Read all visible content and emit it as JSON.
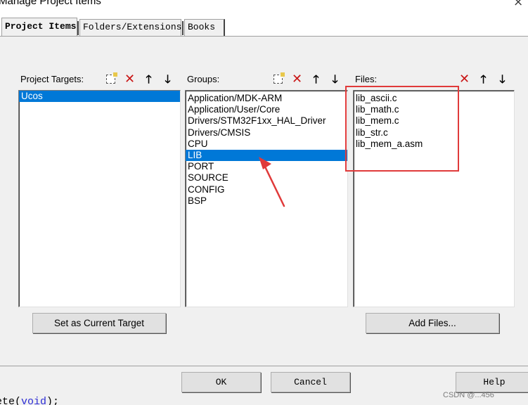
{
  "window": {
    "title": "Manage Project Items",
    "close_glyph": "×"
  },
  "tabs": [
    {
      "label": "Project Items",
      "active": true
    },
    {
      "label": "Folders/Extensions",
      "active": false
    },
    {
      "label": "Books",
      "active": false
    }
  ],
  "targets": {
    "label": "Project Targets:",
    "items": [
      "Ucos"
    ],
    "selected": "Ucos",
    "button": "Set as Current Target"
  },
  "groups": {
    "label": "Groups:",
    "items": [
      "Application/MDK-ARM",
      "Application/User/Core",
      "Drivers/STM32F1xx_HAL_Driver",
      "Drivers/CMSIS",
      "CPU",
      "LIB",
      "PORT",
      "SOURCE",
      "CONFIG",
      "BSP"
    ],
    "selected": "LIB"
  },
  "files": {
    "label": "Files:",
    "items": [
      "lib_ascii.c",
      "lib_math.c",
      "lib_mem.c",
      "lib_str.c",
      "lib_mem_a.asm"
    ],
    "button": "Add Files..."
  },
  "toolbar_icons": {
    "new": "new-item-icon",
    "delete": "delete-icon",
    "up": "move-up-icon",
    "down": "move-down-icon"
  },
  "footer": {
    "ok": "OK",
    "cancel": "Cancel",
    "help": "Help"
  },
  "annotation": {
    "color": "#e03a3a"
  },
  "watermark": "CSDN @...456",
  "code_fragment": {
    "prefix": "ete(",
    "keyword": "void",
    "suffix": ");"
  },
  "colors": {
    "selection": "#0078d7",
    "panel": "#f0f0f0"
  }
}
